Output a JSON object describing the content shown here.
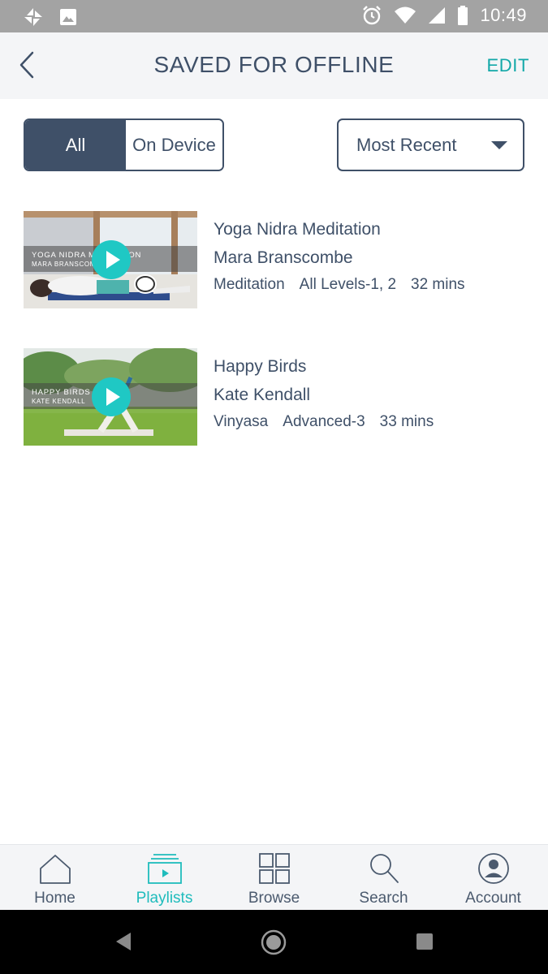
{
  "status_bar": {
    "time": "10:49"
  },
  "header": {
    "title": "SAVED FOR OFFLINE",
    "edit_label": "EDIT"
  },
  "filters": {
    "segments": [
      "All",
      "On Device"
    ],
    "selected_segment": "All",
    "sort_label": "Most Recent"
  },
  "classes": [
    {
      "thumb_title": "YOGA NIDRA MEDITATION",
      "thumb_teacher": "MARA BRANSCOMBE",
      "title": "Yoga Nidra Meditation",
      "teacher": "Mara Branscombe",
      "style": "Meditation",
      "level": "All Levels-1, 2",
      "duration": "32 mins"
    },
    {
      "thumb_title": "HAPPY BIRDS",
      "thumb_teacher": "KATE KENDALL",
      "title": "Happy Birds",
      "teacher": "Kate Kendall",
      "style": "Vinyasa",
      "level": "Advanced-3",
      "duration": "33 mins"
    }
  ],
  "bottom_nav": {
    "items": [
      {
        "label": "Home",
        "icon": "home-icon"
      },
      {
        "label": "Playlists",
        "icon": "playlists-icon"
      },
      {
        "label": "Browse",
        "icon": "browse-grid-icon"
      },
      {
        "label": "Search",
        "icon": "search-icon"
      },
      {
        "label": "Account",
        "icon": "account-icon"
      }
    ],
    "active": "Playlists"
  },
  "colors": {
    "primary_text": "#3f5068",
    "accent": "#1fc8c4",
    "edit": "#12a8a8",
    "status_bar": "#a3a3a3",
    "header_bg": "#f4f5f7"
  }
}
